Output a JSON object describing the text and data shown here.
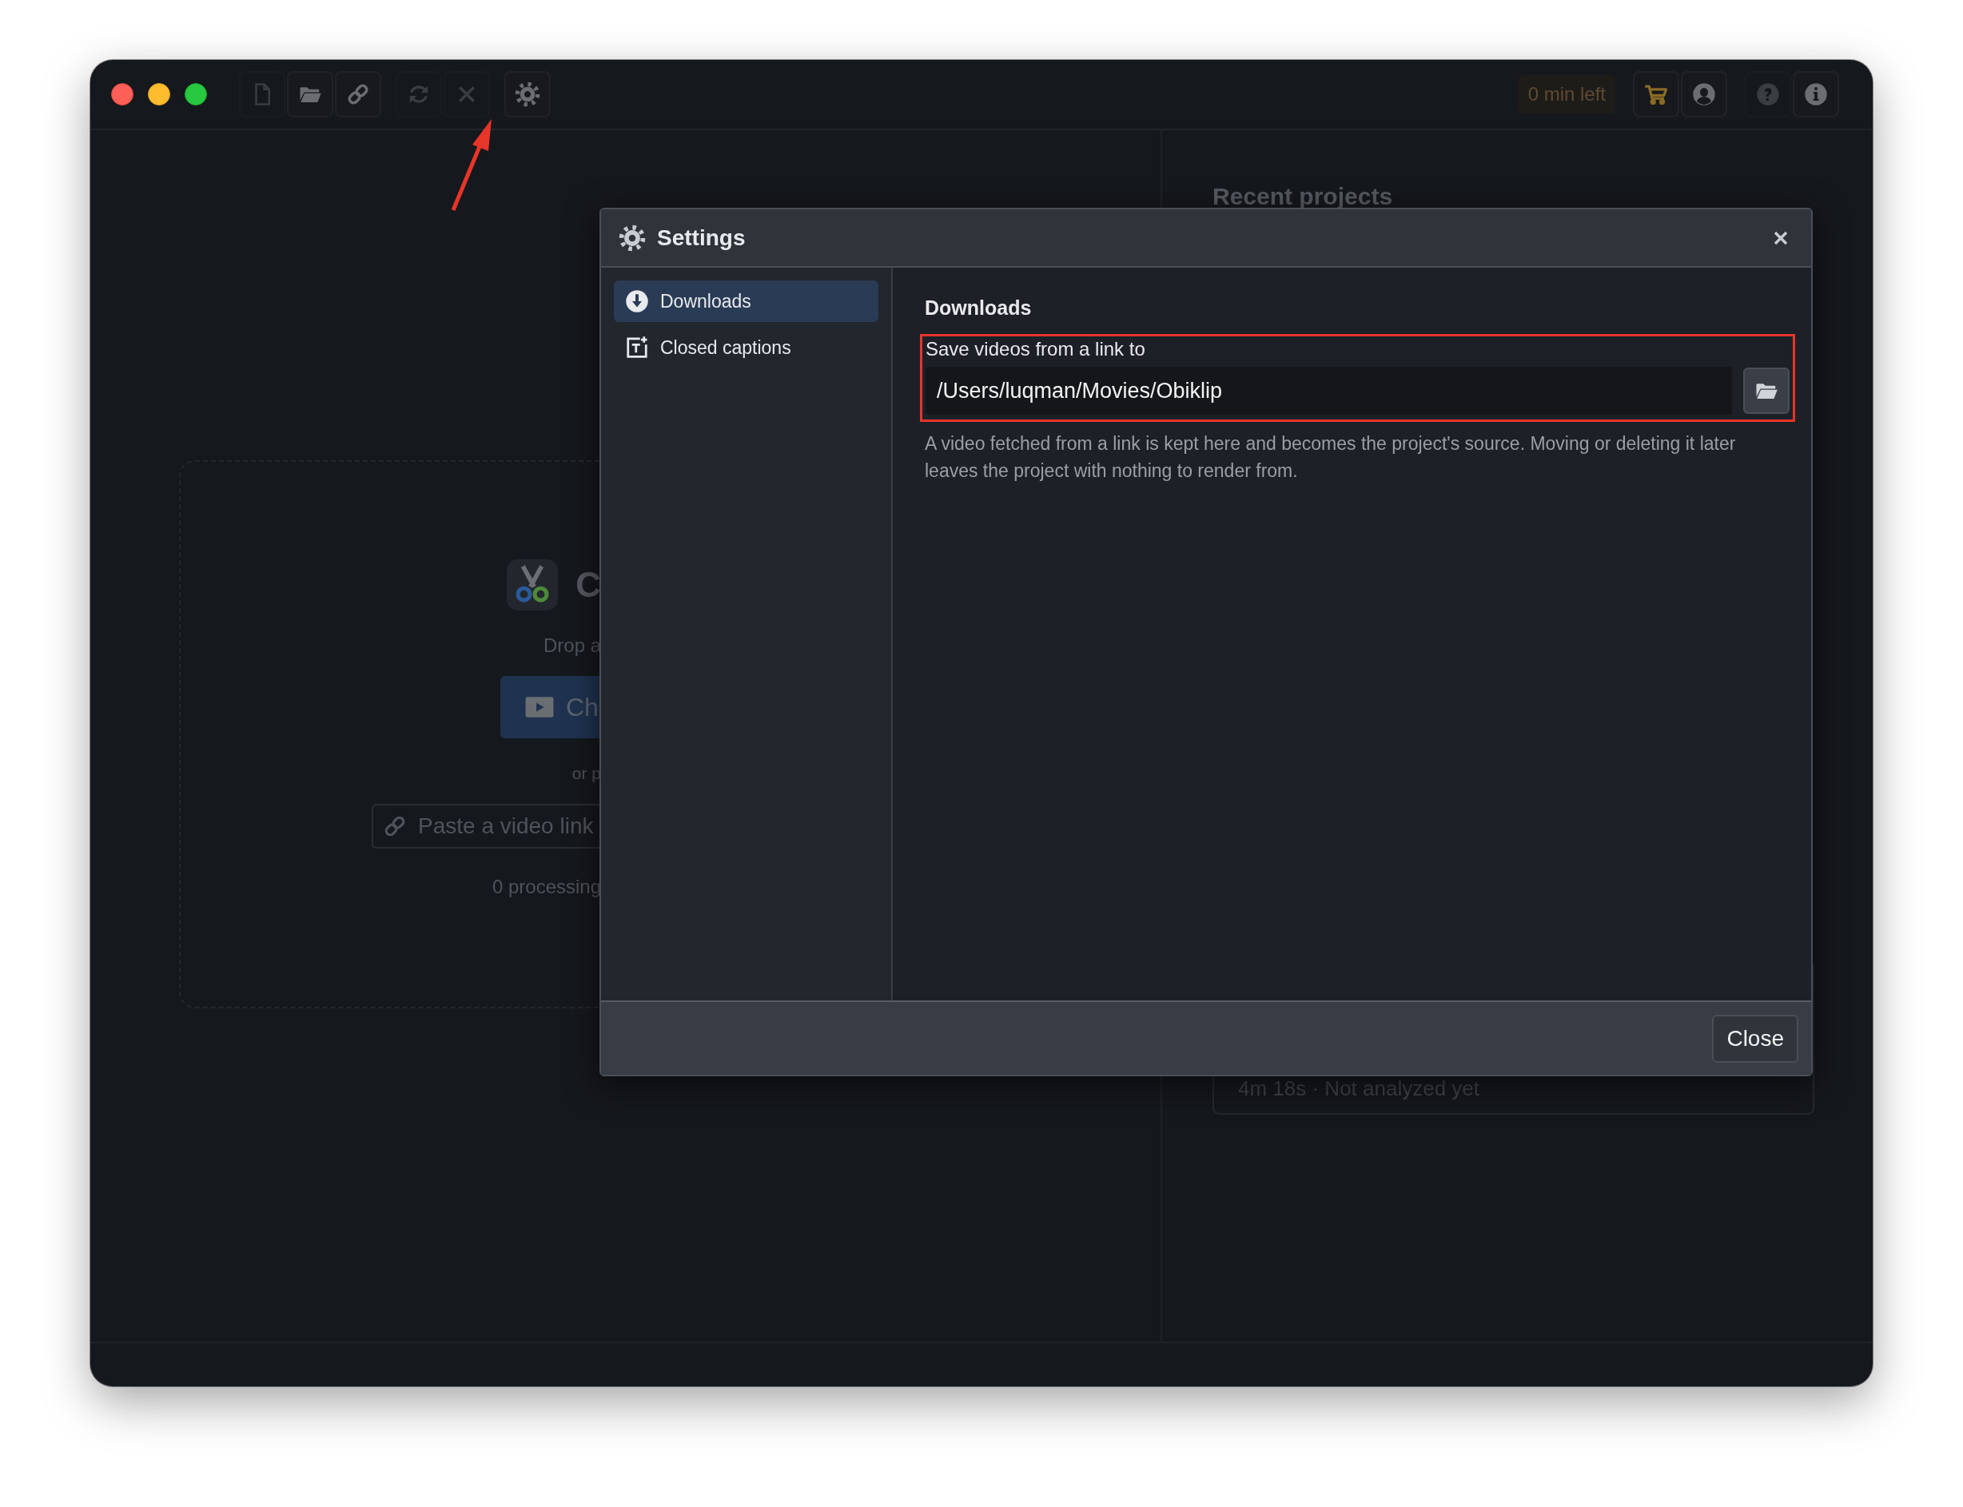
{
  "window": {
    "toolbar": {
      "buttons": [
        {
          "kind": "new-file",
          "disabled": true
        },
        {
          "kind": "open-folder",
          "disabled": false
        },
        {
          "kind": "link",
          "disabled": false
        },
        {
          "kind": "refresh",
          "disabled": true
        },
        {
          "kind": "cancel",
          "disabled": true
        },
        {
          "kind": "settings",
          "disabled": false
        }
      ],
      "credits": "0 min left",
      "right_buttons": [
        {
          "kind": "cart",
          "disabled": false
        },
        {
          "kind": "account",
          "disabled": false
        },
        {
          "kind": "help",
          "disabled": true
        },
        {
          "kind": "info",
          "disabled": false
        }
      ]
    },
    "home": {
      "title": "C",
      "drop_hint": "Drop a",
      "choose_button": "Ch",
      "or_text": "or p",
      "link_placeholder": "Paste a video link",
      "status": "0 processing"
    },
    "recent": {
      "title": "Recent projects",
      "card_meta": "4m 18s · Not analyzed yet"
    }
  },
  "settings": {
    "title": "Settings",
    "sections": [
      {
        "label": "Downloads",
        "kind": "download",
        "selected": true
      },
      {
        "label": "Closed captions",
        "kind": "captions",
        "selected": false
      }
    ],
    "heading": "Downloads",
    "field_label": "Save videos from a link to",
    "field_value": "/Users/luqman/Movies/Obiklip",
    "help": "A video fetched from a link is kept here and becomes the project's source. Moving or deleting it later leaves the project with nothing to render from.",
    "footer_button": "Close"
  }
}
